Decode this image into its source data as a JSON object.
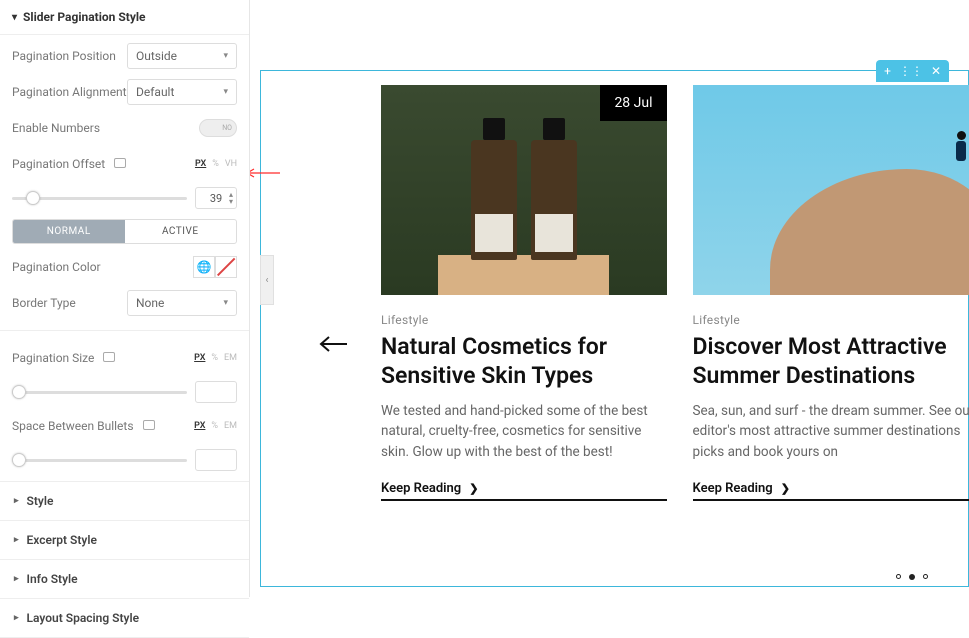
{
  "sidebar": {
    "section_title": "Slider Pagination Style",
    "position": {
      "label": "Pagination Position",
      "value": "Outside"
    },
    "alignment": {
      "label": "Pagination Alignment",
      "value": "Default"
    },
    "enable_numbers": {
      "label": "Enable Numbers",
      "toggle_text": "NO"
    },
    "offset": {
      "label": "Pagination Offset",
      "units": [
        "PX",
        "%",
        "VH"
      ],
      "active_unit": "PX",
      "value": "39"
    },
    "tabs": {
      "normal": "NORMAL",
      "active": "ACTIVE"
    },
    "color": {
      "label": "Pagination Color"
    },
    "border": {
      "label": "Border Type",
      "value": "None"
    },
    "size": {
      "label": "Pagination Size",
      "units": [
        "PX",
        "%",
        "EM"
      ],
      "active_unit": "PX",
      "value": ""
    },
    "space": {
      "label": "Space Between Bullets",
      "units": [
        "PX",
        "%",
        "EM"
      ],
      "active_unit": "PX",
      "value": ""
    },
    "accordions": [
      "Style",
      "Excerpt Style",
      "Info Style",
      "Layout Spacing Style"
    ]
  },
  "preview": {
    "handle": {
      "add": "+",
      "grid": "⋮⋮",
      "close": "✕"
    },
    "cards": [
      {
        "date": "28 Jul",
        "category": "Lifestyle",
        "title": "Natural Cosmetics for Sensitive Skin Types",
        "excerpt": "We tested and hand-picked some of the best natural, cruelty-free, cosmetics for sensitive skin. Glow up with the best of the best!",
        "cta": "Keep Reading"
      },
      {
        "category": "Lifestyle",
        "title": "Discover Most Attractive Summer Destinations",
        "excerpt": "Sea, sun, and surf - the dream summer. See our editor's most attractive summer destinations picks and book yours on",
        "cta": "Keep Reading"
      }
    ]
  }
}
